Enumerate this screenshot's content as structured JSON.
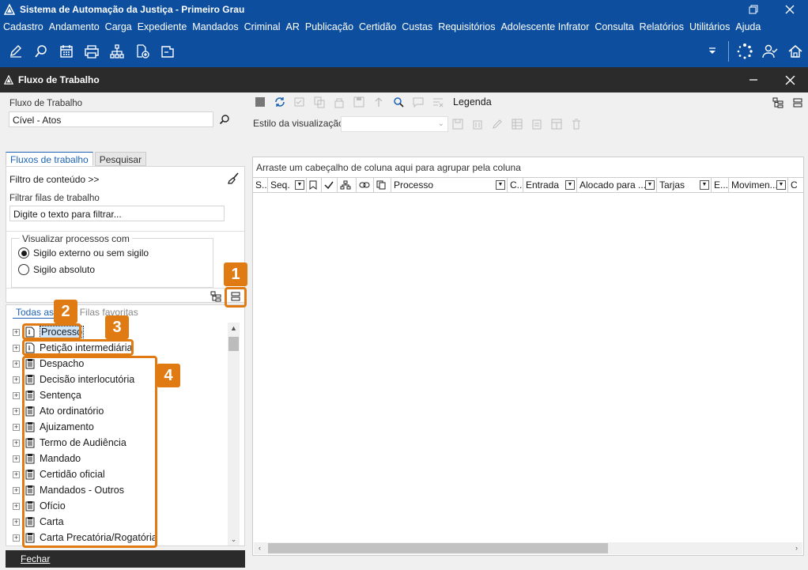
{
  "window": {
    "title": "Sistema de Automação da Justiça - Primeiro Grau"
  },
  "menu": [
    "Cadastro",
    "Andamento",
    "Carga",
    "Expediente",
    "Mandados",
    "Criminal",
    "AR",
    "Publicação",
    "Certidão",
    "Custas",
    "Requisitórios",
    "Adolescente Infrator",
    "Consulta",
    "Relatórios",
    "Utilitários",
    "Ajuda"
  ],
  "toolbar_icons": [
    "edit-icon",
    "search-icon",
    "calendar-icon",
    "printer-icon",
    "hierarchy-icon",
    "add-document-icon",
    "folder-icon"
  ],
  "panel": {
    "title": "Fluxo de Trabalho"
  },
  "left": {
    "flow_label": "Fluxo de Trabalho",
    "flow_value": "Cível - Atos",
    "tabs": [
      "Fluxos de trabalho",
      "Pesquisar"
    ],
    "filter_content": "Filtro de conteúdo >>",
    "filter_queues_label": "Filtrar filas de trabalho",
    "filter_queues_value": "Digite o texto para filtrar...",
    "visualize_label": "Visualizar processos com",
    "radio_external": "Sigilo externo ou sem sigilo",
    "radio_absolute": "Sigilo absoluto",
    "tree_tabs": [
      "Todas as filas",
      "Filas favoritas"
    ],
    "tree_items": [
      "Processo",
      "Petição intermediária",
      "Despacho",
      "Decisão interlocutória",
      "Sentença",
      "Ato ordinatório",
      "Ajuizamento",
      "Termo de Audiência",
      "Mandado",
      "Certidão oficial",
      "Mandados - Outros",
      "Ofício",
      "Carta",
      "Carta Precatória/Rogatória"
    ],
    "close": "Fechar"
  },
  "right": {
    "legend": "Legenda",
    "style_label": "Estilo da visualização",
    "group_hint": "Arraste um cabeçalho de coluna aqui para agrupar pela coluna",
    "columns": [
      "S...",
      "Seq.",
      "",
      "",
      "",
      "",
      "",
      "Processo",
      "C...",
      "Entrada",
      "Alocado para ...",
      "Tarjas",
      "E...",
      "Movimen...",
      "C"
    ]
  },
  "callouts": [
    "1",
    "2",
    "3",
    "4"
  ],
  "colors": {
    "titlebar": "#0d4f9e",
    "subbar": "#2b2b2b",
    "accent": "#e07b14",
    "link": "#1c63b5"
  }
}
